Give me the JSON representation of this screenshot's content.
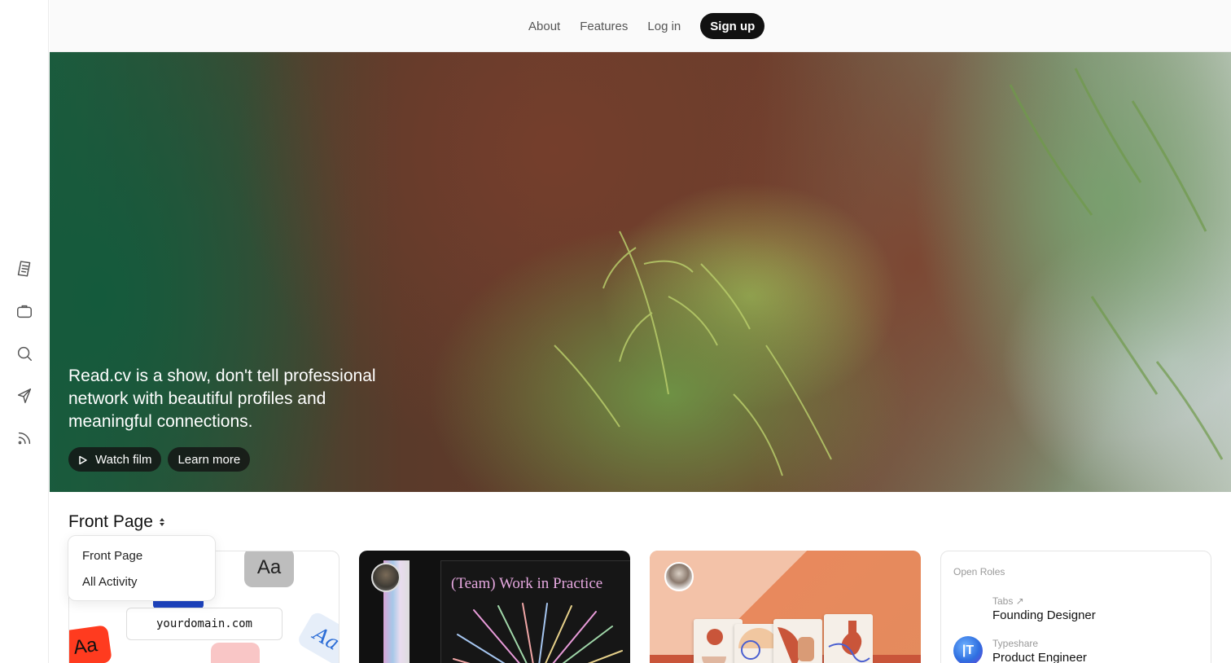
{
  "nav": {
    "about": "About",
    "features": "Features",
    "login": "Log in",
    "signup": "Sign up"
  },
  "sidebar": {
    "icons": [
      "document-icon",
      "briefcase-icon",
      "search-icon",
      "send-icon",
      "rss-icon"
    ]
  },
  "hero": {
    "tagline": "Read.cv is a show, don't tell professional network with beautiful profiles and meaningful connections.",
    "watch_film": "Watch film",
    "learn_more": "Learn more"
  },
  "feed": {
    "title": "Front Page",
    "dropdown": [
      "Front Page",
      "All Activity"
    ]
  },
  "card1": {
    "domain": "yourdomain.com",
    "aa": "Aa"
  },
  "card2": {
    "poster_title": "(Team) Work in Practice"
  },
  "open_roles": {
    "title": "Open Roles",
    "roles": [
      {
        "company": "Tabs ↗",
        "role": "Founding Designer",
        "logo_text": "",
        "color": "#ffffff"
      },
      {
        "company": "Typeshare",
        "role": "Product Engineer",
        "logo_text": "|T",
        "color": "#2f6fe0"
      }
    ]
  },
  "colors": {
    "accent_dark": "#111111",
    "nav_text": "#555555"
  }
}
